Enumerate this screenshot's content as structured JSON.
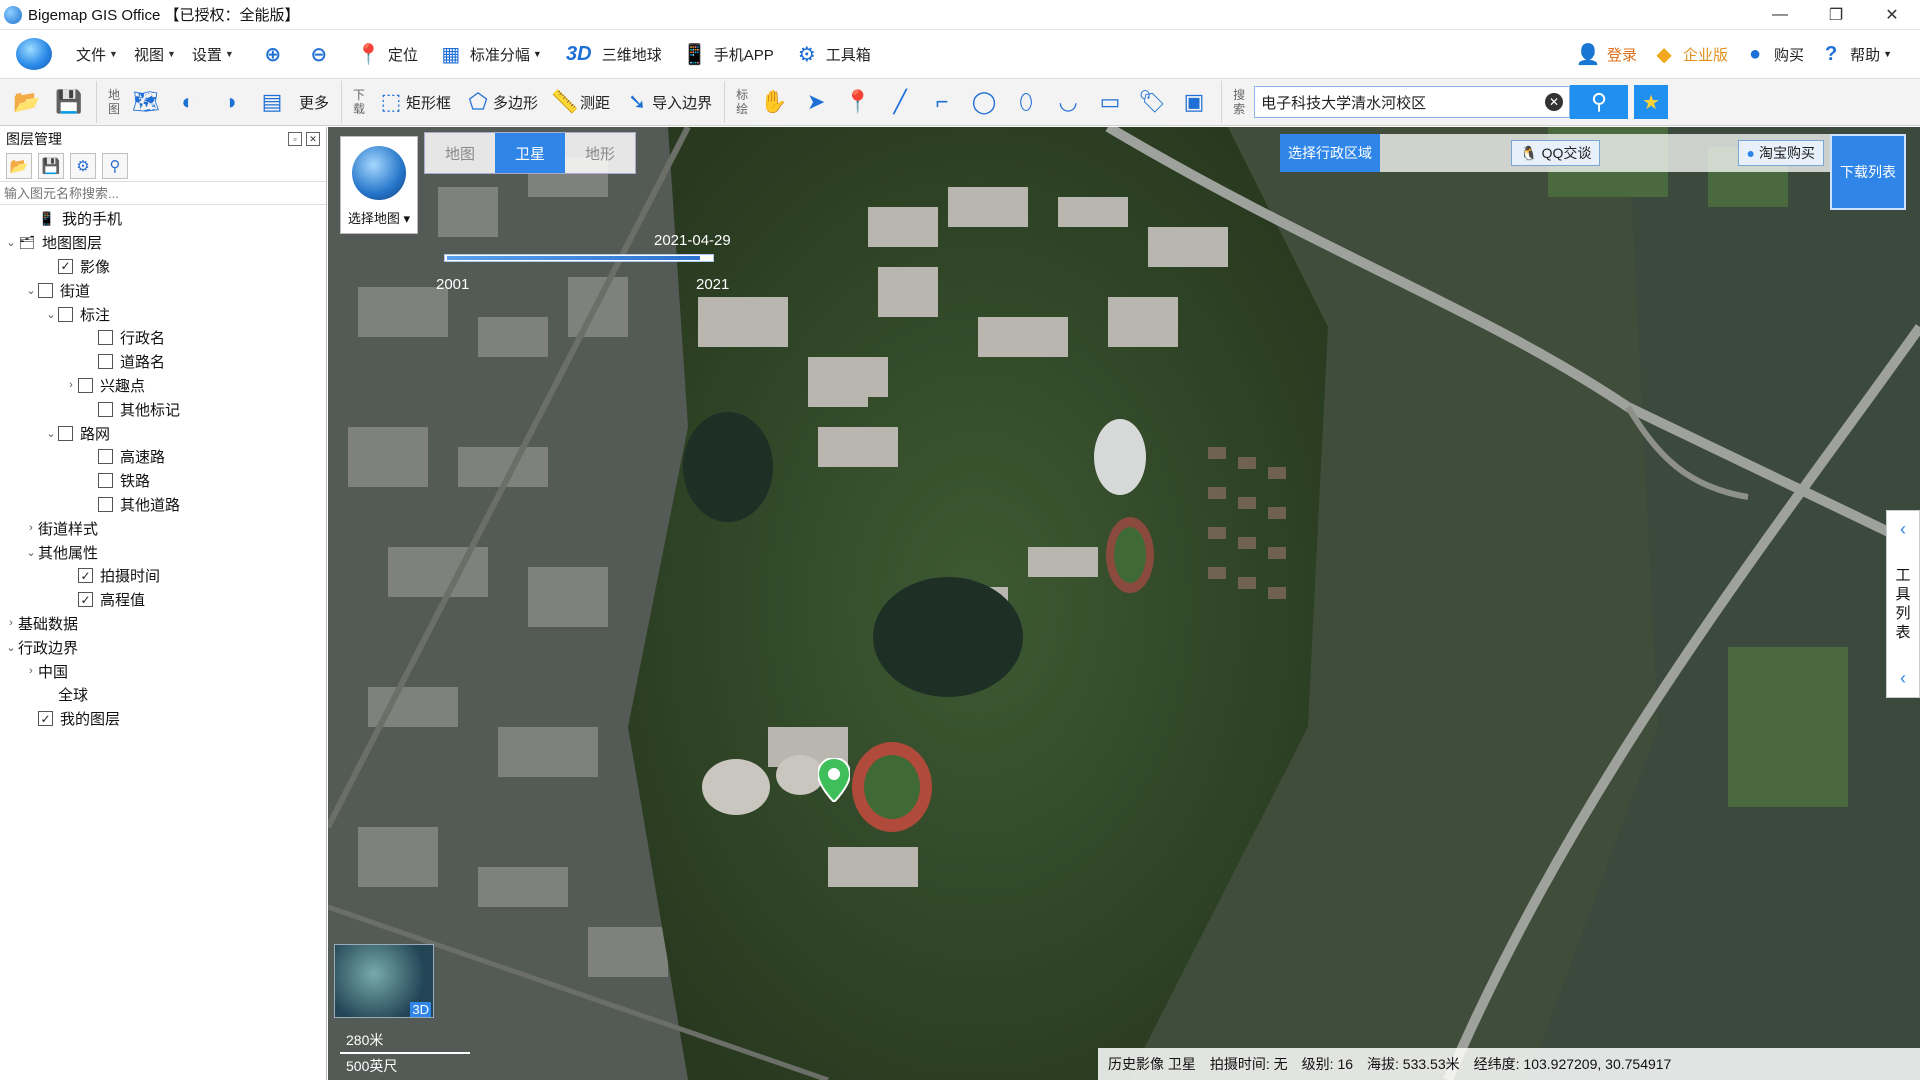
{
  "titlebar": {
    "title": "Bigemap GIS Office 【已授权：全能版】",
    "buttons": {
      "minimize": "—",
      "restore": "❐",
      "close": "✕"
    }
  },
  "menu": {
    "items": [
      {
        "label": "文件"
      },
      {
        "label": "视图"
      },
      {
        "label": "设置"
      }
    ],
    "tools": {
      "locate": "定位",
      "standard_sheet": "标准分幅",
      "earth3d_prefix": "3D",
      "earth3d": "三维地球",
      "mobile_app": "手机APP",
      "toolbox": "工具箱"
    },
    "right": {
      "login": "登录",
      "enterprise": "企业版",
      "buy": "购买",
      "help": "帮助"
    }
  },
  "toolbar": {
    "map_label": "地图",
    "more": "更多",
    "download_label": "下载",
    "rect_box": "矩形框",
    "polygon": "多边形",
    "measure": "测距",
    "import_boundary": "导入边界",
    "mark_label": "标绘",
    "search_label": "搜索",
    "search_value": "电子科技大学清水河校区"
  },
  "layer_panel": {
    "title": "图层管理",
    "search_placeholder": "输入图元名称搜索...",
    "tree": [
      {
        "label": "我的手机",
        "level": 1,
        "toggle": "",
        "checkbox": false,
        "icon": "phone"
      },
      {
        "label": "地图图层",
        "level": 0,
        "toggle": "expanded",
        "checkbox": false,
        "icon": "layers"
      },
      {
        "label": "影像",
        "level": 2,
        "toggle": "",
        "checkbox": true,
        "checked": true
      },
      {
        "label": "街道",
        "level": 1,
        "toggle": "expanded",
        "checkbox": true,
        "checked": false
      },
      {
        "label": "标注",
        "level": 2,
        "toggle": "expanded",
        "checkbox": true,
        "checked": false
      },
      {
        "label": "行政名",
        "level": 4,
        "toggle": "",
        "checkbox": true,
        "checked": false
      },
      {
        "label": "道路名",
        "level": 4,
        "toggle": "",
        "checkbox": true,
        "checked": false
      },
      {
        "label": "兴趣点",
        "level": 3,
        "toggle": "collapsed",
        "checkbox": true,
        "checked": false
      },
      {
        "label": "其他标记",
        "level": 4,
        "toggle": "",
        "checkbox": true,
        "checked": false
      },
      {
        "label": "路网",
        "level": 2,
        "toggle": "expanded",
        "checkbox": true,
        "checked": false
      },
      {
        "label": "高速路",
        "level": 4,
        "toggle": "",
        "checkbox": true,
        "checked": false
      },
      {
        "label": "铁路",
        "level": 4,
        "toggle": "",
        "checkbox": true,
        "checked": false
      },
      {
        "label": "其他道路",
        "level": 4,
        "toggle": "",
        "checkbox": true,
        "checked": false
      },
      {
        "label": "街道样式",
        "level": 1,
        "toggle": "collapsed",
        "checkbox": false
      },
      {
        "label": "其他属性",
        "level": 1,
        "toggle": "expanded",
        "checkbox": false
      },
      {
        "label": "拍摄时间",
        "level": 3,
        "toggle": "",
        "checkbox": true,
        "checked": true
      },
      {
        "label": "高程值",
        "level": 3,
        "toggle": "",
        "checkbox": true,
        "checked": true
      },
      {
        "label": "基础数据",
        "level": 0,
        "toggle": "collapsed",
        "checkbox": false
      },
      {
        "label": "行政边界",
        "level": 0,
        "toggle": "expanded",
        "checkbox": false
      },
      {
        "label": "中国",
        "level": 1,
        "toggle": "collapsed",
        "checkbox": false
      },
      {
        "label": "全球",
        "level": 2,
        "toggle": "",
        "checkbox": false
      },
      {
        "label": "我的图层",
        "level": 1,
        "toggle": "",
        "checkbox": true,
        "checked": true
      }
    ]
  },
  "map": {
    "selector_label": "选择地图",
    "tabs": [
      {
        "label": "地图",
        "active": false
      },
      {
        "label": "卫星",
        "active": true
      },
      {
        "label": "地形",
        "active": false
      }
    ],
    "timeline": {
      "date": "2021-04-29",
      "start": "2001",
      "end": "2021",
      "position": 0.95
    },
    "region_button": "选择行政区域",
    "qq_button": "QQ交谈",
    "taobao_button": "淘宝购买",
    "download_list": "下载列表",
    "side_tools": "工具列表",
    "minimap_label": "3D",
    "scale": {
      "metric": "280米",
      "imperial": "500英尺"
    },
    "status": {
      "history": "历史影像 卫星",
      "capture_time": "拍摄时间: 无",
      "level": "级别:  16",
      "altitude": "海拔: 533.53米",
      "coords": "经纬度:   103.927209, 30.754917"
    },
    "colors": {
      "accent": "#2f86e8",
      "marker": "#3fbf5a"
    }
  }
}
